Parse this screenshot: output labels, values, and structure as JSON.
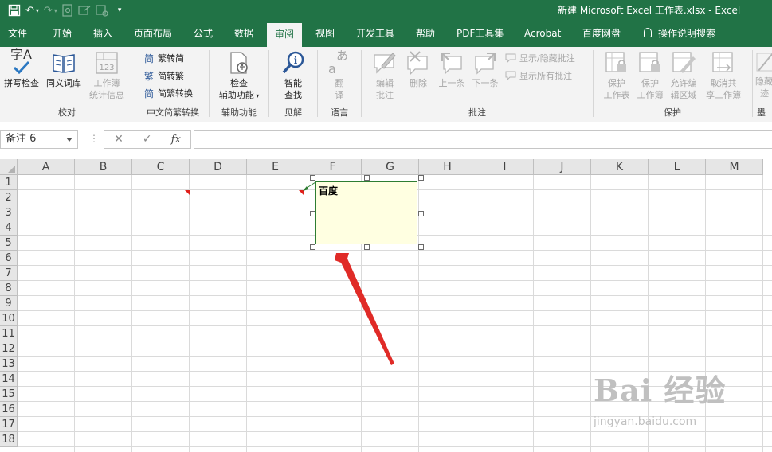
{
  "window": {
    "title": "新建 Microsoft Excel 工作表.xlsx  -  Excel"
  },
  "qat": {
    "undo_symbol": "↶",
    "redo_symbol": "↷"
  },
  "tabs": [
    "文件",
    "开始",
    "插入",
    "页面布局",
    "公式",
    "数据",
    "审阅",
    "视图",
    "开发工具",
    "帮助",
    "PDF工具集",
    "Acrobat",
    "百度网盘",
    "操作说明搜索"
  ],
  "active_tab": "审阅",
  "ribbon": {
    "proofing": {
      "label": "校对",
      "spell": "拼写检查",
      "thesaurus": "同义词库",
      "stats_l1": "工作簿",
      "stats_l2": "统计信息",
      "spell_glyph": "字A"
    },
    "chinese": {
      "label": "中文简繁转换",
      "to_trad": "繁转简",
      "to_simp": "简转繁",
      "convert": "简繁转换",
      "g1": "简",
      "g2": "繁",
      "g3": "简"
    },
    "accessibility": {
      "label": "辅助功能",
      "l1": "检查",
      "l2": "辅助功能"
    },
    "insights": {
      "label": "见解",
      "l1": "智能",
      "l2": "查找"
    },
    "language": {
      "label": "语言",
      "l1": "翻",
      "l2": "译",
      "glyph": "あ"
    },
    "comments": {
      "label": "批注",
      "edit_l1": "编辑",
      "edit_l2": "批注",
      "delete": "删除",
      "prev": "上一条",
      "next": "下一条",
      "show_hide": "显示/隐藏批注",
      "show_all": "显示所有批注"
    },
    "protect": {
      "label": "保护",
      "sheet_l1": "保护",
      "sheet_l2": "工作表",
      "wb_l1": "保护",
      "wb_l2": "工作簿",
      "allow_l1": "允许编",
      "allow_l2": "辑区域",
      "unshare_l1": "取消共",
      "unshare_l2": "享工作簿"
    },
    "ink": {
      "label": "墨",
      "l1": "隐藏",
      "l2": "迹"
    }
  },
  "formula_bar": {
    "name_box": "备注 6",
    "dots": "⋮",
    "cancel": "✕",
    "enter": "✓",
    "fx": "fx"
  },
  "columns": [
    "A",
    "B",
    "C",
    "D",
    "E",
    "F",
    "G",
    "H",
    "I",
    "J",
    "K",
    "L",
    "M"
  ],
  "rows": [
    "1",
    "2",
    "3",
    "4",
    "5",
    "6",
    "7",
    "8",
    "9",
    "10",
    "11",
    "12",
    "13",
    "14",
    "15",
    "16",
    "17",
    "18"
  ],
  "comment": {
    "text": "百度"
  },
  "watermark": {
    "big": "Bai 经验",
    "small": "jingyan.baidu.com"
  },
  "colors": {
    "excel_green": "#217346",
    "arrow_red": "#e02b27",
    "comment_fill": "#ffffe1"
  }
}
